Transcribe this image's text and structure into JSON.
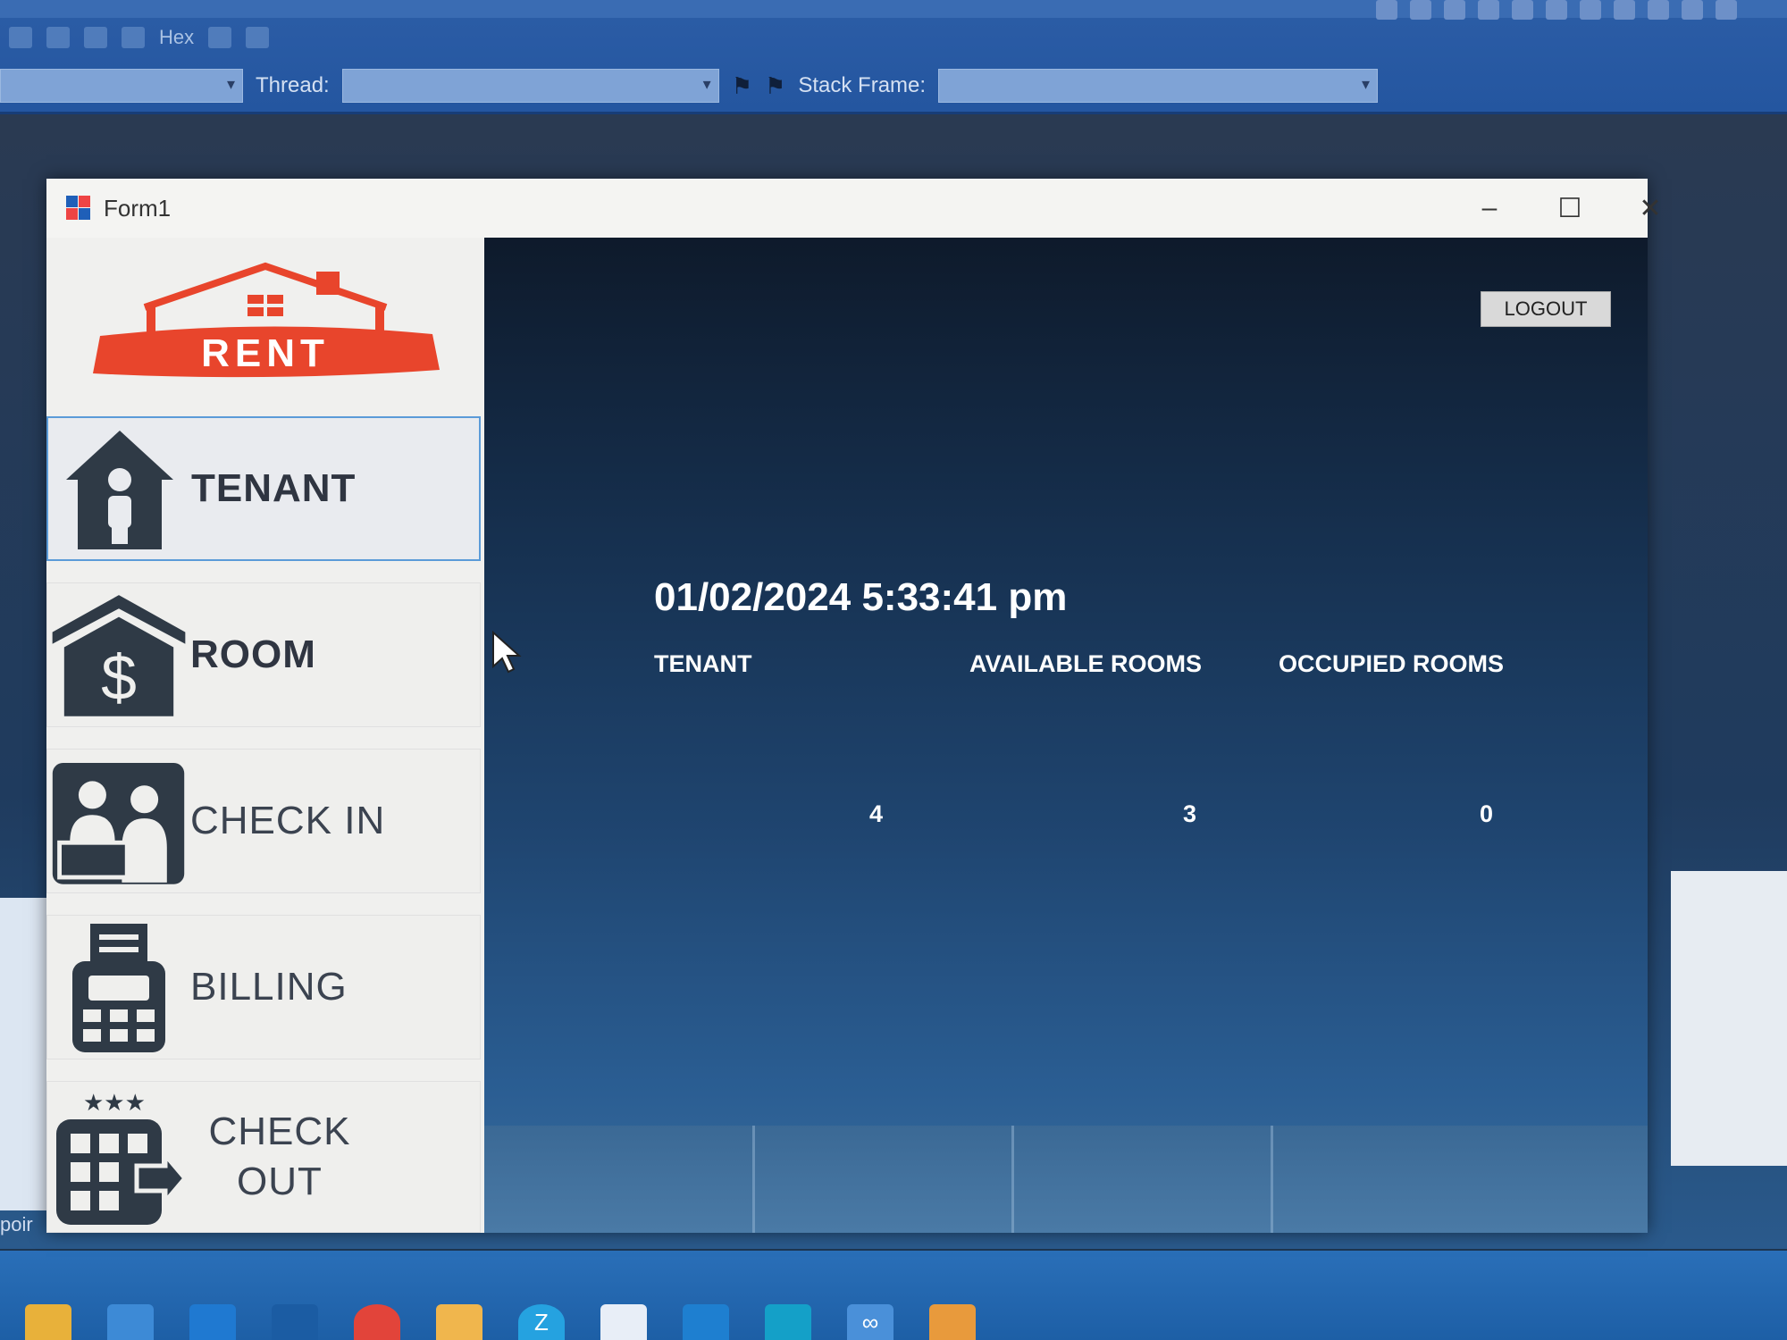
{
  "ide": {
    "thread_label": "Thread:",
    "stack_frame_label": "Stack Frame:",
    "hex_label": "Hex",
    "status_text": "poir"
  },
  "form": {
    "title": "Form1"
  },
  "sidebar": {
    "logo_text": "RENT",
    "items": [
      {
        "label": "TENANT",
        "icon": "tenant-house-icon"
      },
      {
        "label": "ROOM",
        "icon": "room-dollar-icon"
      },
      {
        "label": "CHECK IN",
        "icon": "check-in-people-icon"
      },
      {
        "label": "BILLING",
        "icon": "billing-terminal-icon"
      },
      {
        "label": "CHECK OUT",
        "icon": "check-out-hotel-icon"
      }
    ]
  },
  "main": {
    "logout_label": "LOGOUT",
    "datetime": "01/02/2024 5:33:41 pm",
    "stats": [
      {
        "label": "TENANT",
        "value": "4"
      },
      {
        "label": "AVAILABLE ROOMS",
        "value": "3"
      },
      {
        "label": "OCCUPIED ROOMS",
        "value": "0"
      }
    ]
  },
  "colors": {
    "brand_red": "#e8452c",
    "icon_dark": "#2f3a46",
    "active_border": "#5b9bd8"
  }
}
